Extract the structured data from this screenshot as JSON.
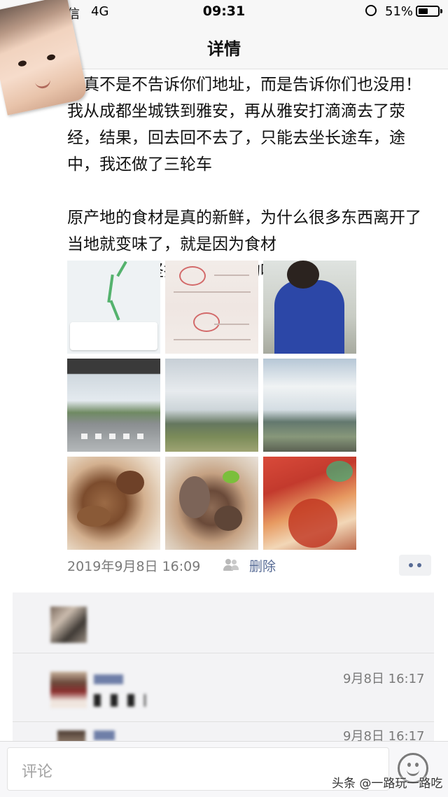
{
  "status_bar": {
    "carrier": "信",
    "network": "4G",
    "time": "09:31",
    "battery_percent": "51%",
    "battery_level": 0.51
  },
  "nav": {
    "title": "详情"
  },
  "post": {
    "text": "我真不是不告诉你们地址，而是告诉你们也没用！我从成都坐城铁到雅安，再从雅安打滴滴去了荥经，结果，回去回不去了，只能去坐长途车，途中，我还做了三轮车\n\n原产地的食材是真的新鲜，为什么很多东西离开了当地就变味了，就是因为食材\n而我，是个坚持追寻本源的吃货",
    "photos": [
      "map-screenshot",
      "train-tickets",
      "person-blue-jacket",
      "road-view",
      "cloudy-mountains",
      "cloudy-field",
      "braised-food",
      "braised-food-2",
      "shop-sign"
    ],
    "timestamp": "2019年9月8日 16:09",
    "delete_label": "删除"
  },
  "comments": [
    {
      "time": "9月8日 16:17"
    },
    {
      "time": "9月8日 16:17"
    }
  ],
  "bottom_bar": {
    "placeholder": "评论",
    "watermark": "头条 @一路玩一路吃"
  },
  "colors": {
    "link": "#576b95",
    "bar_bg": "#f7f7f7",
    "comment_bg": "#f3f3f5"
  }
}
